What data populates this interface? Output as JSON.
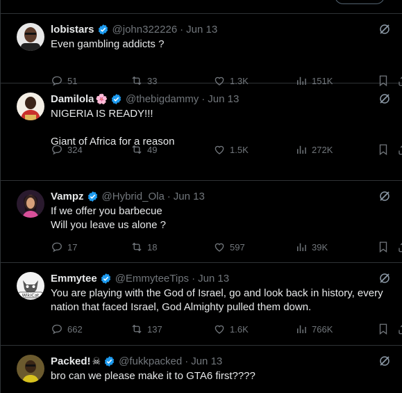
{
  "tweets": [
    {
      "name": "lobistars",
      "emoji": "",
      "handle": "@john322226",
      "date": "Jun 13",
      "text": "Even gambling addicts ?",
      "replies": "51",
      "reposts": "33",
      "likes": "1.3K",
      "views": "151K"
    },
    {
      "name": "Damilola",
      "emoji": "🌸",
      "handle": "@thebigdammy",
      "date": "Jun 13",
      "text": "NIGERIA IS READY!!!\n\nGiant of Africa for a reason",
      "replies": "324",
      "reposts": "49",
      "likes": "1.5K",
      "views": "272K"
    },
    {
      "name": "Vampz",
      "emoji": "",
      "handle": "@Hybrid_Ola",
      "date": "Jun 13",
      "text": "If we offer you barbecue\nWill you leave us alone ?",
      "replies": "17",
      "reposts": "18",
      "likes": "597",
      "views": "39K"
    },
    {
      "name": "Emmytee",
      "emoji": "",
      "handle": "@EmmyteeTips",
      "date": "Jun 13",
      "text": "You are playing with the God of Israel, go and look back in history, every nation that faced Israel, God Almighty pulled them down.",
      "replies": "662",
      "reposts": "137",
      "likes": "1.6K",
      "views": "766K"
    },
    {
      "name": "Packed!",
      "emoji": "☠",
      "handle": "@fukkpacked",
      "date": "Jun 13",
      "text": "bro can we please make it to GTA6 first????",
      "replies": "",
      "reposts": "",
      "likes": "",
      "views": ""
    }
  ],
  "icons": {
    "verified": "verified-badge-icon",
    "grok": "grok-icon",
    "reply": "reply-icon",
    "repost": "repost-icon",
    "like": "like-icon",
    "views": "views-icon",
    "bookmark": "bookmark-icon",
    "share": "share-icon"
  },
  "colors": {
    "background": "#000000",
    "text": "#e7e9ea",
    "muted": "#71767b",
    "divider": "#2f3336",
    "verified": "#1d9bf0"
  }
}
